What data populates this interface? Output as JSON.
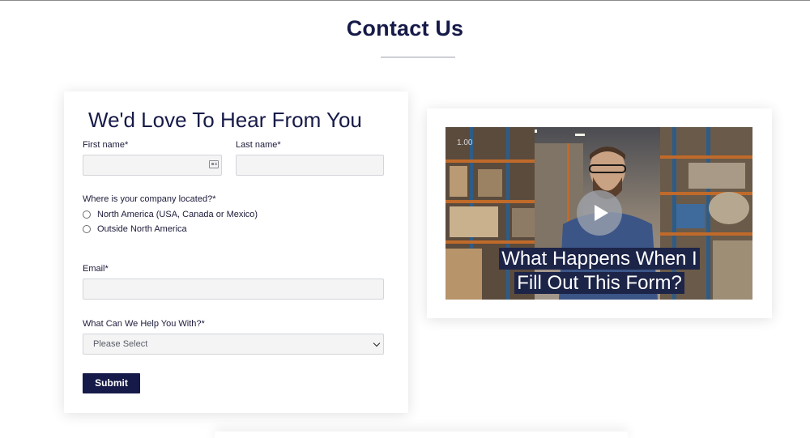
{
  "page": {
    "title": "Contact Us"
  },
  "form": {
    "heading": "We'd Love To Hear From You",
    "first_name_label": "First name*",
    "first_name_value": "",
    "last_name_label": "Last name*",
    "last_name_value": "",
    "location_question": "Where is your company located?*",
    "location_options": [
      "North America (USA, Canada or Mexico)",
      "Outside North America"
    ],
    "email_label": "Email*",
    "email_value": "",
    "help_label": "What Can We Help You With?*",
    "help_selected": "Please Select",
    "submit_label": "Submit"
  },
  "video": {
    "caption_line1": "What Happens When I",
    "caption_line2": "Fill Out This Form?",
    "speed": "1.00"
  },
  "colors": {
    "brand_navy": "#161a48",
    "field_bg": "#f4f4f5",
    "field_border": "#d3d5da"
  }
}
